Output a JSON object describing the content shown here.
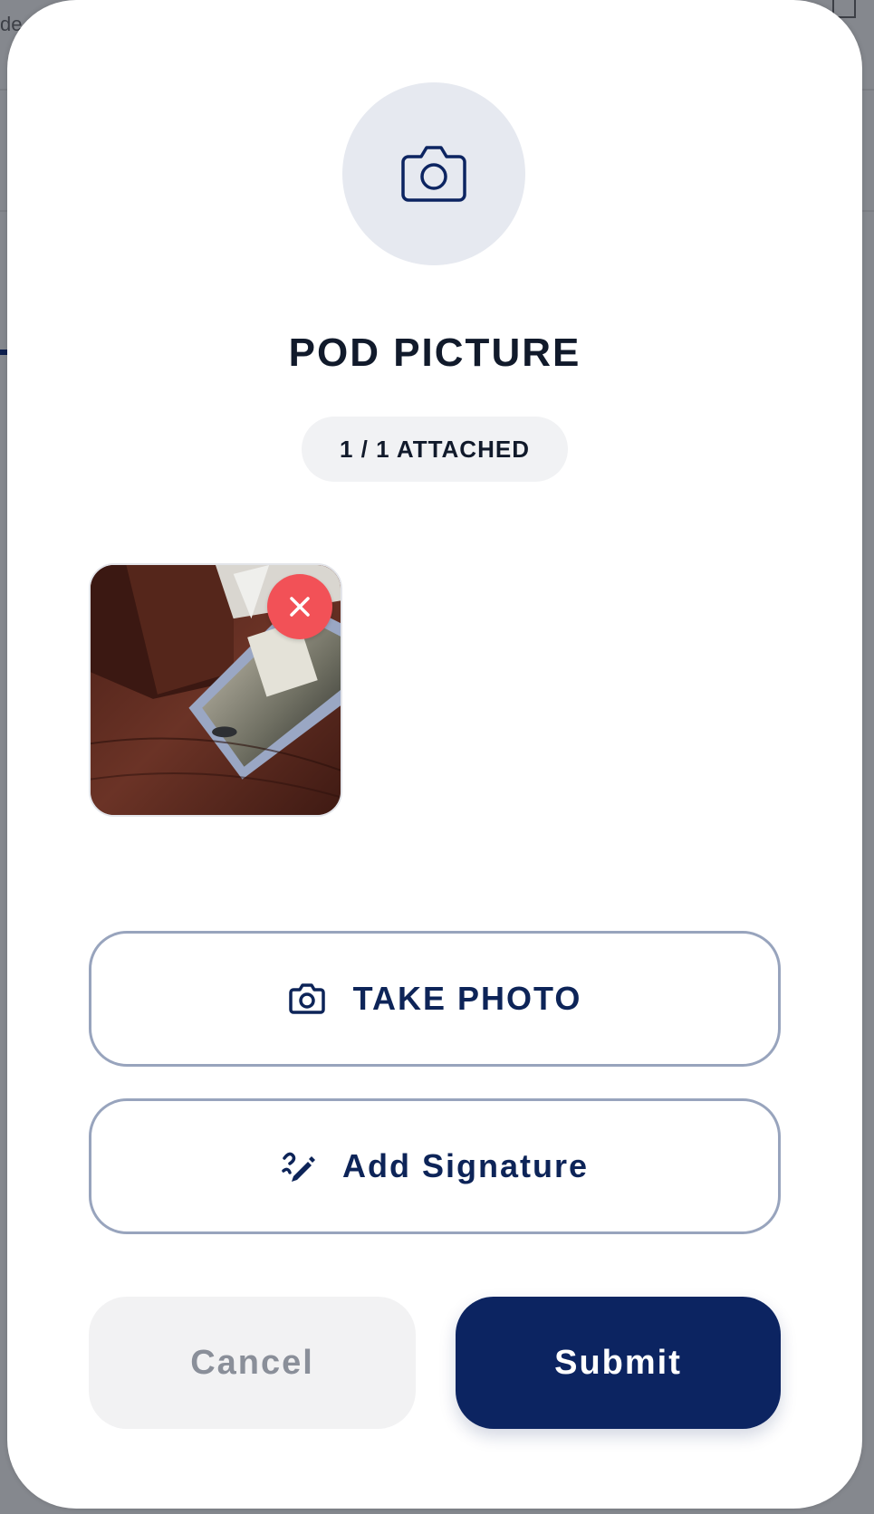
{
  "modal": {
    "title": "POD PICTURE",
    "attached_badge": "1 / 1 ATTACHED",
    "header_icon": "camera-icon",
    "attachments": [
      {
        "kind": "photo",
        "remove_icon": "close-icon"
      }
    ],
    "actions": {
      "take_photo_label": "TAKE PHOTO",
      "take_photo_icon": "camera-icon",
      "add_signature_label": "Add Signature",
      "add_signature_icon": "signature-pen-icon"
    },
    "footer": {
      "cancel_label": "Cancel",
      "submit_label": "Submit"
    }
  },
  "background": {
    "partial_text": "de"
  },
  "colors": {
    "primary": "#0c2461",
    "remove": "#f25157",
    "outline": "#98a4bd",
    "hero_circle": "#e6e9f0",
    "cancel_bg": "#f2f2f3",
    "cancel_text": "#8a8f99"
  }
}
